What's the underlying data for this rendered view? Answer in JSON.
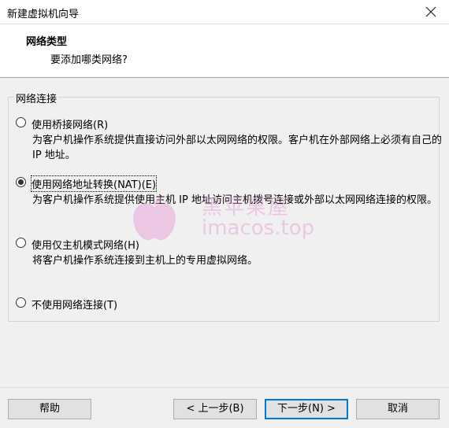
{
  "window": {
    "title": "新建虚拟机向导"
  },
  "header": {
    "title": "网络类型",
    "subtitle": "要添加哪类网络?"
  },
  "group": {
    "legend": "网络连接",
    "options": [
      {
        "label": "使用桥接网络(R)",
        "description": "为客户机操作系统提供直接访问外部以太网网络的权限。客户机在外部网络上必须有自己的 IP 地址。",
        "selected": false
      },
      {
        "label": "使用网络地址转换(NAT)(E)",
        "description": "为客户机操作系统提供使用主机 IP 地址访问主机拨号连接或外部以太网网络连接的权限。",
        "selected": true
      },
      {
        "label": "使用仅主机模式网络(H)",
        "description": "将客户机操作系统连接到主机上的专用虚拟网络。",
        "selected": false
      },
      {
        "label": "不使用网络连接(T)",
        "description": "",
        "selected": false
      }
    ]
  },
  "watermark": {
    "cn": "黑苹果屋",
    "en": "imacos.top"
  },
  "footer": {
    "help": "帮助",
    "back": "< 上一步(B)",
    "next": "下一步(N) >",
    "cancel": "取消"
  },
  "colors": {
    "accent": "#0078d7",
    "watermark": "#e8a0d8"
  },
  "icons": {
    "close": "close-icon",
    "watermark": "apple-logo"
  }
}
